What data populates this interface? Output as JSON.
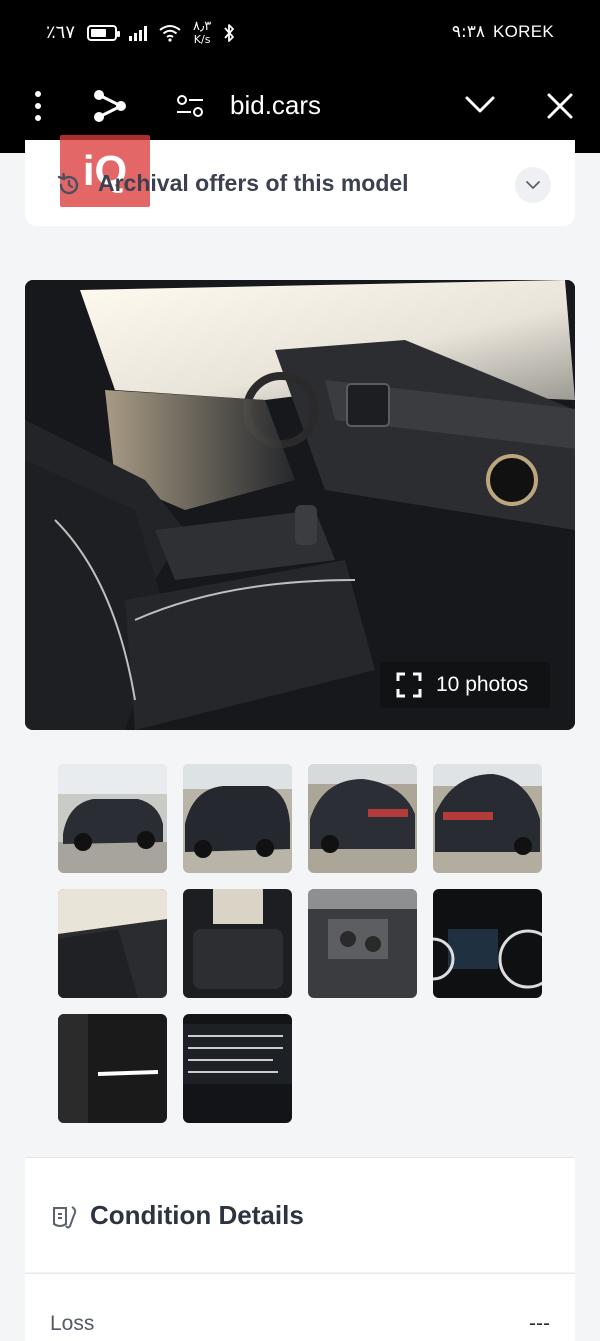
{
  "status_bar": {
    "battery_percent": "٪٦٧",
    "battery_level": 0.67,
    "net_speed_value": "٨٫٣",
    "net_speed_unit": "K/s",
    "time": "٩:٣٨",
    "carrier": "KOREK"
  },
  "browser": {
    "url": "bid.cars",
    "icons": [
      "more-vertical-icon",
      "share-icon",
      "site-settings-icon",
      "chevron-down-icon",
      "close-icon"
    ]
  },
  "archival": {
    "title": "Archival offers of this model",
    "watermark": "iQ",
    "icons": [
      "history-icon",
      "chevron-down-icon"
    ]
  },
  "gallery": {
    "photo_count_label": "10 photos",
    "thumbnails": [
      {
        "name": "thumb-front-left-exterior"
      },
      {
        "name": "thumb-front-right-exterior"
      },
      {
        "name": "thumb-rear-left-exterior"
      },
      {
        "name": "thumb-rear-right-exterior"
      },
      {
        "name": "thumb-interior-dashboard"
      },
      {
        "name": "thumb-rear-seats"
      },
      {
        "name": "thumb-engine-bay"
      },
      {
        "name": "thumb-instrument-cluster"
      },
      {
        "name": "thumb-door-jamb"
      },
      {
        "name": "thumb-vin-label"
      }
    ]
  },
  "condition": {
    "title": "Condition Details",
    "rows": [
      {
        "label": "Loss",
        "value": "---"
      }
    ]
  }
}
